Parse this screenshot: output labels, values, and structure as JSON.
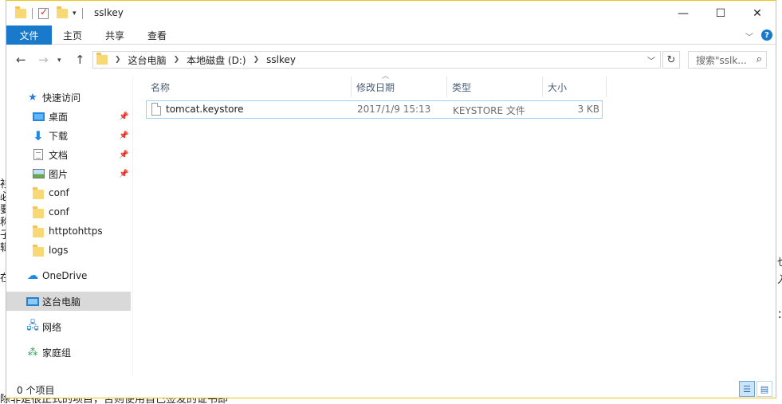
{
  "background_fragments": [
    {
      "text": "衫"
    },
    {
      "text": "必"
    },
    {
      "text": "要"
    },
    {
      "text": "称"
    },
    {
      "text": "子"
    },
    {
      "text": "辑"
    },
    {
      "text": "在"
    },
    {
      "text": "也"
    },
    {
      "text": "入"
    },
    {
      "text": "："
    },
    {
      "text": "除非是很正式的项目，否则使用自己签发的证书即"
    }
  ],
  "titlebar": {
    "title": "sslkey",
    "minimize": "—",
    "maximize": "☐",
    "close": "✕"
  },
  "ribbon": {
    "tabs": [
      "文件",
      "主页",
      "共享",
      "查看"
    ],
    "help": "?"
  },
  "address": {
    "crumbs": [
      "这台电脑",
      "本地磁盘 (D:)",
      "sslkey"
    ],
    "search_placeholder": "搜索\"sslk..."
  },
  "nav": {
    "quick_access": "快速访问",
    "items": [
      {
        "label": "桌面",
        "icon": "desktop-icon",
        "pinned": true
      },
      {
        "label": "下载",
        "icon": "download-icon",
        "pinned": true
      },
      {
        "label": "文档",
        "icon": "document-icon",
        "pinned": true
      },
      {
        "label": "图片",
        "icon": "pictures-icon",
        "pinned": true
      },
      {
        "label": "conf",
        "icon": "folder-icon",
        "pinned": false
      },
      {
        "label": "conf",
        "icon": "folder-icon",
        "pinned": false
      },
      {
        "label": "httptohttps",
        "icon": "folder-icon",
        "pinned": false
      },
      {
        "label": "logs",
        "icon": "folder-icon",
        "pinned": false
      }
    ],
    "onedrive": "OneDrive",
    "this_pc": "这台电脑",
    "network": "网络",
    "homegroup": "家庭组"
  },
  "columns": [
    "名称",
    "修改日期",
    "类型",
    "大小"
  ],
  "files": [
    {
      "name": "tomcat.keystore",
      "modified": "2017/1/9 15:13",
      "type": "KEYSTORE 文件",
      "size": "3 KB"
    }
  ],
  "status": {
    "count": "0 个项目"
  },
  "colors": {
    "accent": "#1979ca",
    "window_border": "#f0c419",
    "selection": "#d9d9d9",
    "row_hover_border": "#99d1ff"
  }
}
